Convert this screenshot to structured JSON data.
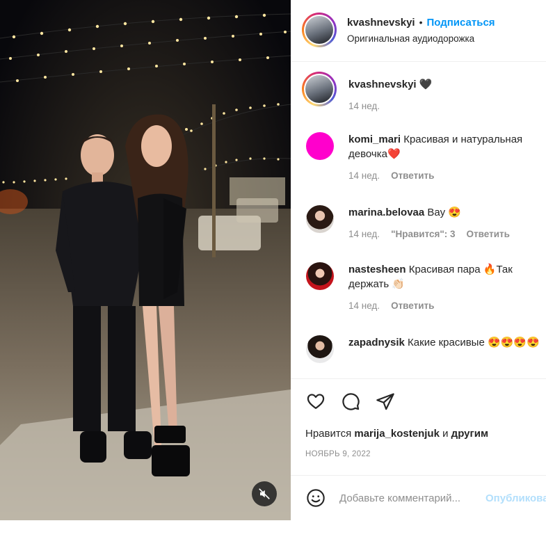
{
  "header": {
    "username": "kvashnevskyi",
    "separator": "•",
    "follow_label": "Подписаться",
    "audio_label": "Оригинальная аудиодорожка"
  },
  "caption": {
    "username": "kvashnevskyi",
    "text": "🖤",
    "time": "14 нед."
  },
  "comments": [
    {
      "username": "komi_mari",
      "text": "Красивая и натуральная девочка❤️",
      "time": "14 нед.",
      "likes": "",
      "reply_label": "Ответить",
      "avatar_color": "#ff00cc"
    },
    {
      "username": "marina.belovaa",
      "text": "Вау 😍",
      "time": "14 нед.",
      "likes": "\"Нравится\": 3",
      "reply_label": "Ответить"
    },
    {
      "username": "nastesheen",
      "text": "Красивая пара 🔥Так держать 👏🏻",
      "time": "14 нед.",
      "likes": "",
      "reply_label": "Ответить"
    },
    {
      "username": "zapadnysik",
      "text": "Какие красивые 😍😍😍😍",
      "time": "",
      "likes": "",
      "reply_label": ""
    }
  ],
  "actions": {
    "icons": [
      "heart-icon",
      "comment-icon",
      "share-icon"
    ],
    "likes_prefix": "Нравится",
    "likes_user": "marija_kostenjuk",
    "likes_conj": "и",
    "likes_others": "другим",
    "date": "НОЯБРЬ 9, 2022"
  },
  "composer": {
    "placeholder": "Добавьте комментарий...",
    "publish_label": "Опубликовать"
  },
  "media": {
    "mute_icon": "muted-speaker-icon"
  },
  "colors": {
    "accent": "#0095f6",
    "muted_text": "#8e8e8e",
    "publish_disabled": "#b2dffc"
  }
}
